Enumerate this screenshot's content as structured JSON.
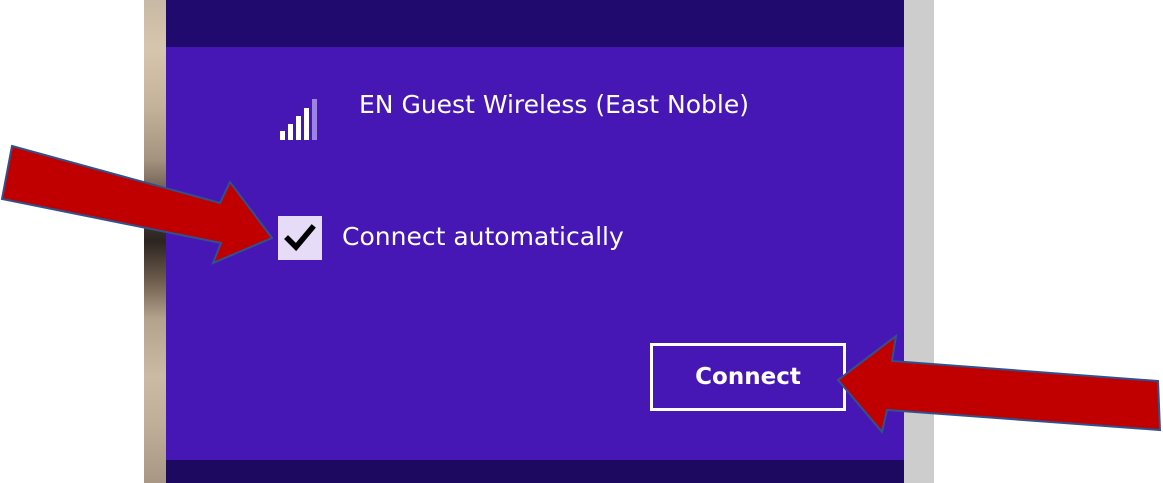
{
  "network": {
    "name": "EN Guest Wireless (East Noble)",
    "signal_icon": "wifi-signal-icon"
  },
  "auto_connect": {
    "label": "Connect automatically",
    "checked": true
  },
  "connect_button": {
    "label": "Connect"
  },
  "colors": {
    "panel_background": "#4617b4",
    "panel_header": "#210a6e",
    "checkbox_fill": "#e6dcf7",
    "annotation_arrow": "#c00000",
    "annotation_arrow_outline": "#2f528f"
  }
}
